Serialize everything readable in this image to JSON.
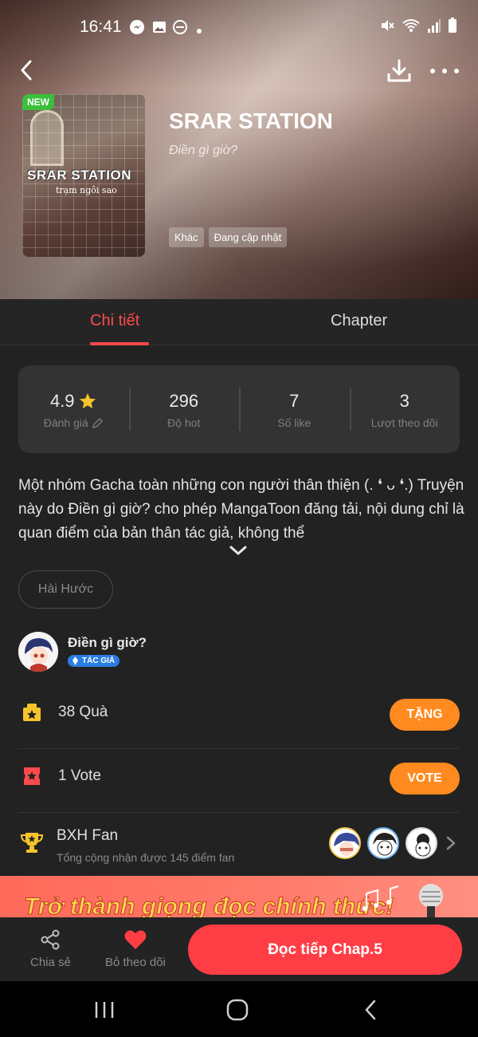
{
  "status_bar": {
    "time": "16:41"
  },
  "nav": {
    "back": "back",
    "download": "download",
    "more": "more"
  },
  "cover": {
    "badge": "NEW",
    "title": "SRAR STATION",
    "subtitle": "trạm ngôi sao"
  },
  "comic": {
    "title": "SRAR STATION",
    "author": "Điền gì giờ?",
    "tags": [
      "Khác",
      "Đang cập nhật"
    ]
  },
  "tabs": [
    {
      "label": "Chi tiết",
      "active": true
    },
    {
      "label": "Chapter",
      "active": false
    }
  ],
  "stats": [
    {
      "value": "4.9",
      "label": "Đánh giá"
    },
    {
      "value": "296",
      "label": "Độ hot"
    },
    {
      "value": "7",
      "label": "Số like"
    },
    {
      "value": "3",
      "label": "Lượt theo dõi"
    }
  ],
  "description": "Một nhóm Gacha toàn những con người thân thiện (. ❛ ᴗ ❛.) Truyện này do Điền gì giờ? cho phép MangaToon đăng tải, nội dung chỉ là quan điểm của bản thân tác giả, không thể",
  "genre_chip": "Hài Hước",
  "author_block": {
    "name": "Điền gì giờ?",
    "badge": "TÁC GIẢ"
  },
  "gifts": {
    "text": "38 Quà",
    "button": "TẶNG"
  },
  "votes": {
    "text": "1 Vote",
    "button": "VOTE"
  },
  "fan_rank": {
    "title": "BXH Fan",
    "subtitle": "Tổng cộng nhận được 145 điểm fan"
  },
  "banner": {
    "text": "Trở thành giọng đọc chính thức!"
  },
  "bottom_bar": {
    "share": "Chia sẻ",
    "unfollow": "Bỏ theo dõi",
    "read": "Đọc tiếp Chap.5"
  },
  "colors": {
    "accent": "#ff4a4a",
    "orange": "#ff8a1f",
    "read_button": "#ff3d45",
    "background": "#222222"
  }
}
